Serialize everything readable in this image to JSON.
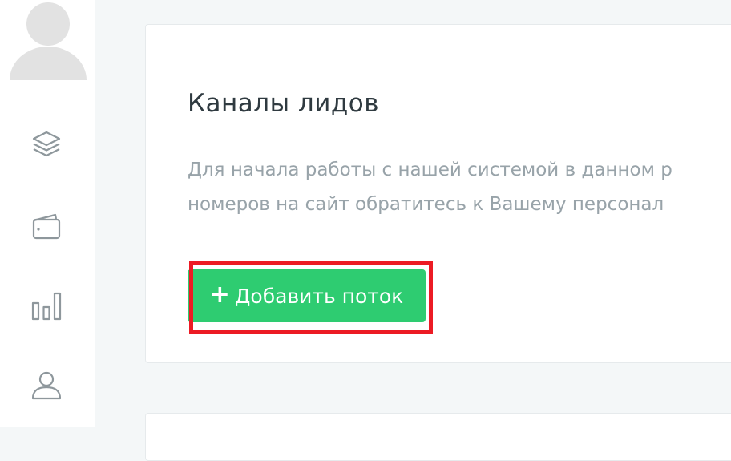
{
  "card": {
    "title": "Каналы лидов",
    "description_line1": "Для начала работы с нашей системой в данном р",
    "description_line2": "номеров на сайт обратитесь к Вашему персонал",
    "add_button_icon": "+",
    "add_button_label": "Добавить поток"
  },
  "sidebar": {
    "items": [
      {
        "icon": "layers-icon"
      },
      {
        "icon": "wallet-icon"
      },
      {
        "icon": "bar-chart-icon"
      },
      {
        "icon": "user-icon"
      }
    ]
  },
  "colors": {
    "accent": "#2ecc71",
    "highlight": "#ec1b24",
    "title": "#2f3a40",
    "muted": "#98a3a9",
    "icon": "#8e979c",
    "background": "#f4f7f8"
  }
}
